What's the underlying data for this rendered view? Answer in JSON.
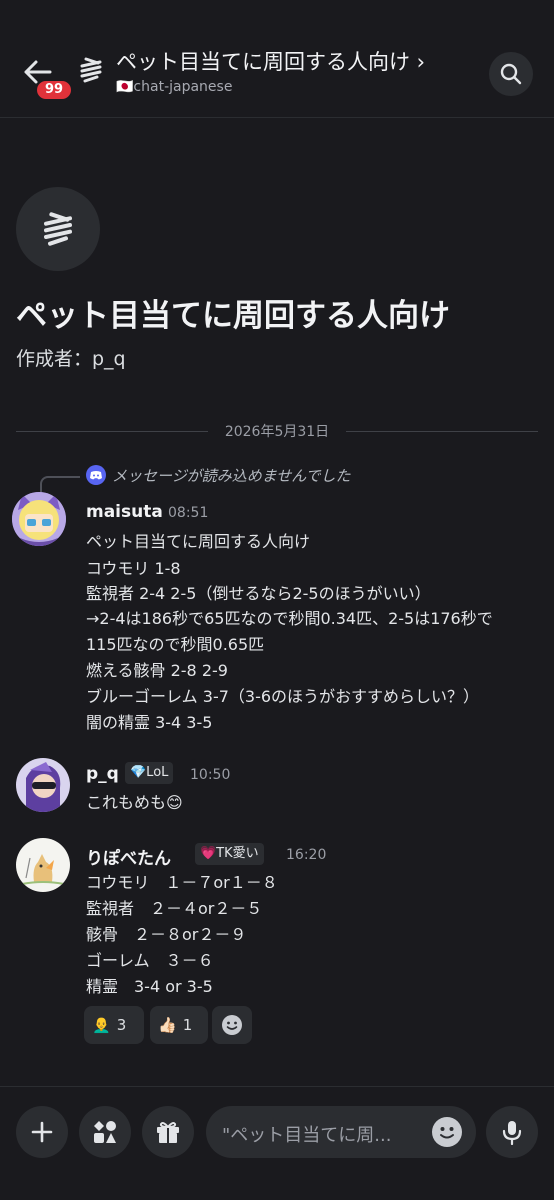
{
  "header": {
    "badge_count": "99",
    "thread_title": "ペット目当てに周回する人向け ›",
    "channel": "🇯🇵chat-japanese"
  },
  "thread": {
    "title": "ペット目当てに周回する人向け",
    "creator": "作成者：p_q"
  },
  "date_divider": "2026年5月31日",
  "reply_ref": "メッセージが読み込めませんでした",
  "messages": [
    {
      "username": "maisuta",
      "time": "08:51",
      "lines": [
        "ペット目当てに周回する人向け",
        "コウモリ 1-8",
        "監視者 2-4 2-5（倒せるなら2-5のほうがいい）",
        "→2-4は186秒で65匹なので秒間0.34匹、2-5は176秒で",
        "115匹なので秒間0.65匹",
        "燃える骸骨 2-8 2-9",
        "ブルーゴーレム 3-7（3-6のほうがおすすめらしい？）",
        "闇の精霊 3-4 3-5"
      ]
    },
    {
      "username": "p_q",
      "role": "💎LoL",
      "time": "10:50",
      "lines": [
        "これもめも😊"
      ]
    },
    {
      "username": "りぽべたん",
      "role": "💗TK愛い",
      "time": "16:20",
      "lines": [
        "コウモリ　１－７or１－８",
        "監視者　２－４or２－５",
        "骸骨　２－８or２－９",
        "ゴーレム　３－６",
        "精霊　3-4 or 3-5"
      ]
    }
  ],
  "reactions": [
    {
      "emoji": "👨‍🦲",
      "count": "3"
    },
    {
      "emoji": "👍🏻",
      "count": "1"
    }
  ],
  "composer": {
    "placeholder": "\"ペット目当てに周..."
  },
  "colors": {
    "background": "#1a1a1e",
    "badge": "#e0323a",
    "discord_blurple": "#5865f2",
    "surface": "#2b2d31"
  },
  "icons": [
    "back-arrow-icon",
    "thread-icon",
    "search-icon",
    "discord-icon",
    "plus-icon",
    "apps-icon",
    "gift-icon",
    "emoji-icon",
    "microphone-icon",
    "add-reaction-icon"
  ]
}
